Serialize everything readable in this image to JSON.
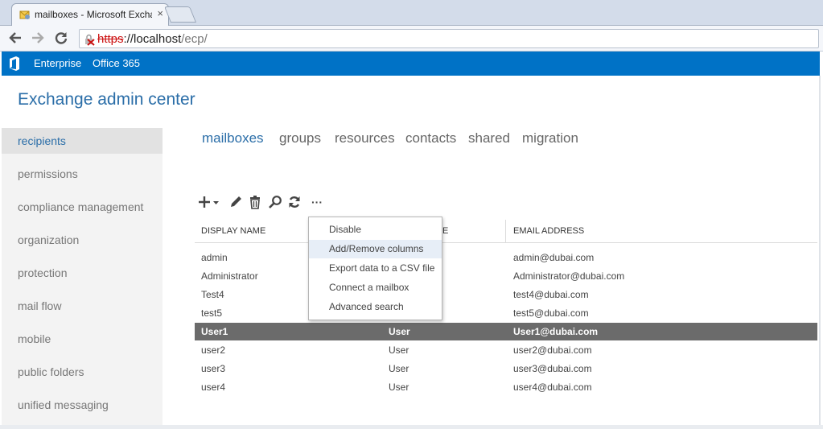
{
  "browser": {
    "tab_title": "mailboxes - Microsoft Exchange",
    "tab_close": "×",
    "url_scheme": "https",
    "url_host": "://localhost",
    "url_path": "/ecp/"
  },
  "topbar": {
    "enterprise": "Enterprise",
    "office365": "Office 365",
    "color": "#0072c6"
  },
  "app": {
    "title": "Exchange admin center",
    "accent": "#2b6ea8"
  },
  "leftnav": {
    "items": [
      {
        "label": "recipients",
        "active": true
      },
      {
        "label": "permissions"
      },
      {
        "label": "compliance management"
      },
      {
        "label": "organization"
      },
      {
        "label": "protection"
      },
      {
        "label": "mail flow"
      },
      {
        "label": "mobile"
      },
      {
        "label": "public folders"
      },
      {
        "label": "unified messaging"
      }
    ]
  },
  "tabs": [
    {
      "label": "mailboxes",
      "active": true
    },
    {
      "label": "groups"
    },
    {
      "label": "resources"
    },
    {
      "label": "contacts"
    },
    {
      "label": "shared"
    },
    {
      "label": "migration"
    }
  ],
  "actions": {
    "more_label": "···",
    "icons": [
      "add-icon",
      "edit-icon",
      "delete-icon",
      "search-icon",
      "refresh-icon",
      "more-icon"
    ]
  },
  "grid": {
    "headers": {
      "display_name": "DISPLAY NAME",
      "type_tail": "E",
      "email": "EMAIL ADDRESS"
    },
    "rows": [
      {
        "name": "admin",
        "type": "",
        "email": "admin@dubai.com"
      },
      {
        "name": "Administrator",
        "type": "",
        "email": "Administrator@dubai.com"
      },
      {
        "name": "Test4",
        "type": "",
        "email": "test4@dubai.com"
      },
      {
        "name": "test5",
        "type": "",
        "email": "test5@dubai.com"
      },
      {
        "name": "User1",
        "type": "User",
        "email": "User1@dubai.com",
        "selected": true
      },
      {
        "name": "user2",
        "type": "User",
        "email": "user2@dubai.com"
      },
      {
        "name": "user3",
        "type": "User",
        "email": "user3@dubai.com"
      },
      {
        "name": "user4",
        "type": "User",
        "email": "user4@dubai.com"
      }
    ]
  },
  "menu": {
    "items": [
      {
        "label": "Disable"
      },
      {
        "label": "Add/Remove columns",
        "hover": true
      },
      {
        "label": "Export data to a CSV file"
      },
      {
        "label": "Connect a mailbox"
      },
      {
        "label": "Advanced search"
      }
    ]
  }
}
